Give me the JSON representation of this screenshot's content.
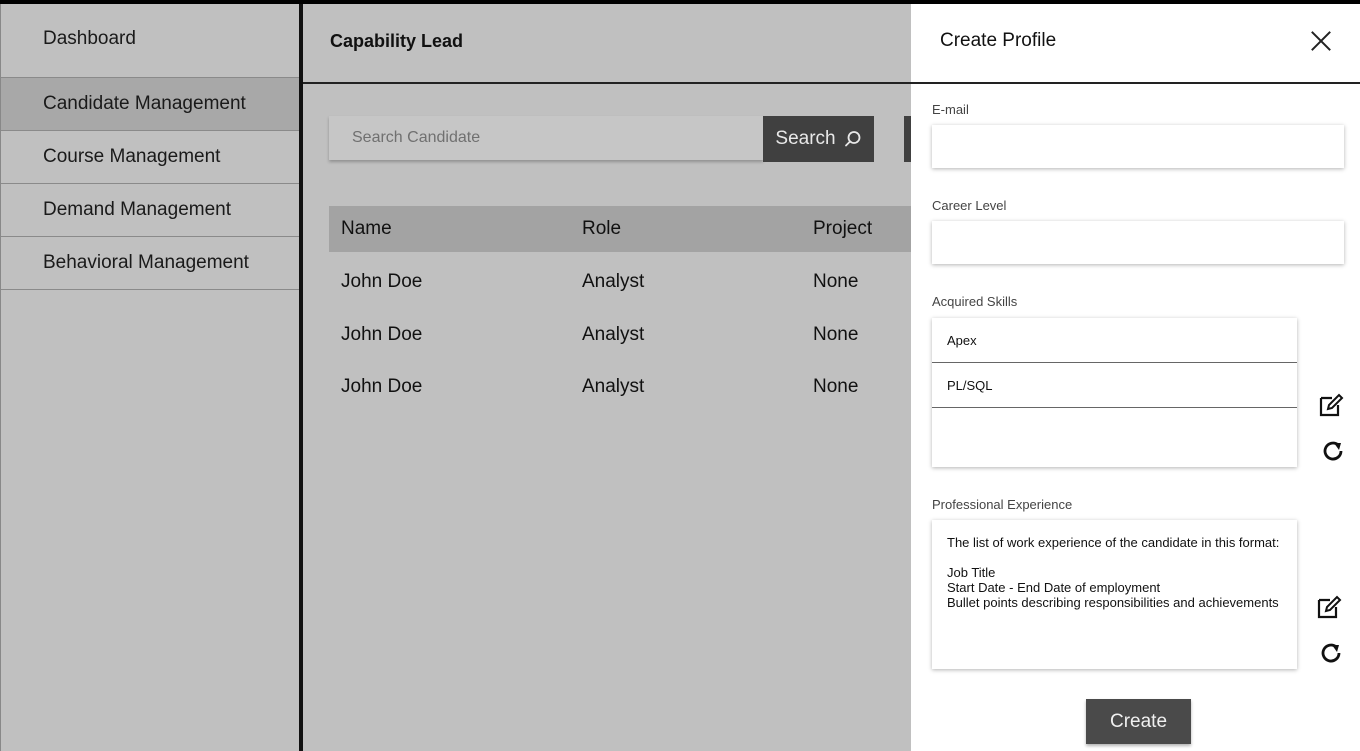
{
  "sidebar": {
    "items": [
      {
        "label": "Dashboard"
      },
      {
        "label": "Candidate Management"
      },
      {
        "label": "Course Management"
      },
      {
        "label": "Demand Management"
      },
      {
        "label": "Behavioral Management"
      }
    ],
    "active_index": 1
  },
  "main": {
    "title": "Capability Lead",
    "search": {
      "placeholder": "Search Candidate",
      "button_label": "Search"
    },
    "table": {
      "headers": [
        "Name",
        "Role",
        "Project"
      ],
      "rows": [
        [
          "John Doe",
          "Analyst",
          "None"
        ],
        [
          "John Doe",
          "Analyst",
          "None"
        ],
        [
          "John Doe",
          "Analyst",
          "None"
        ]
      ]
    }
  },
  "drawer": {
    "title": "Create Profile",
    "email_label": "E-mail",
    "career_label": "Career Level",
    "skills_label": "Acquired Skills",
    "skills": [
      "Apex",
      "PL/SQL"
    ],
    "experience_label": "Professional Experience",
    "experience_lines": [
      "The list of work experience of the candidate in this format:",
      "Job Title",
      "Start Date - End Date of employment",
      "Bullet points describing responsibilities and achievements"
    ],
    "create_label": "Create"
  },
  "icons": {
    "close": "close-icon",
    "search": "search-icon",
    "edit": "edit-icon",
    "refresh": "refresh-icon"
  },
  "colors": {
    "sidebar_bg": "#c0c0c0",
    "active_item": "#a8a8a8",
    "dark_button": "#404040",
    "table_header": "#a3a3a3"
  }
}
